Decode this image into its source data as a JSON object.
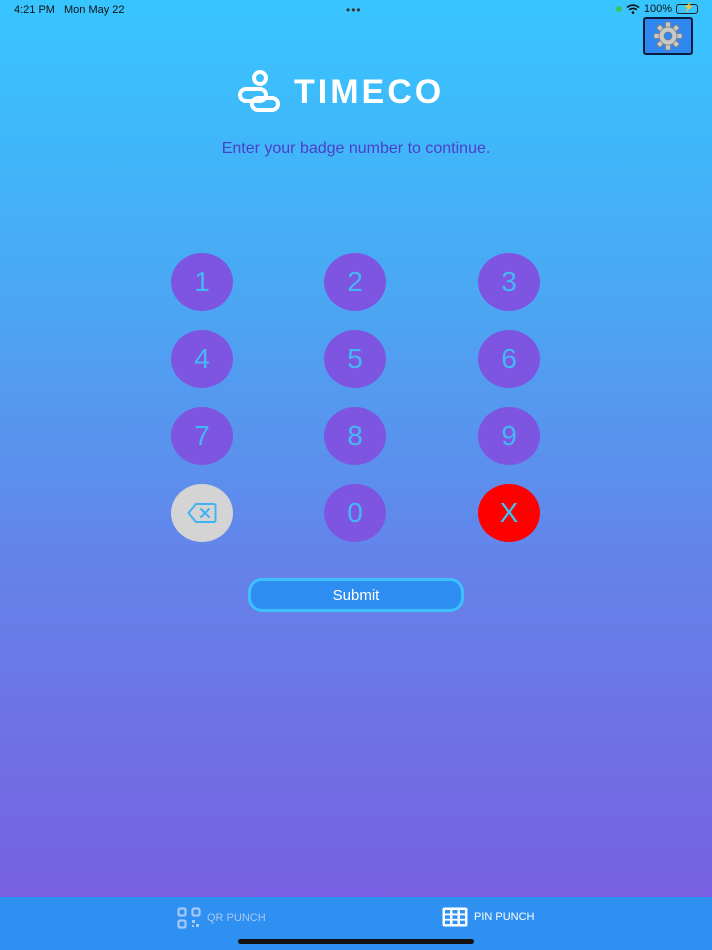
{
  "status_bar": {
    "time": "4:21 PM",
    "date": "Mon May 22",
    "battery": "100%"
  },
  "brand": {
    "name": "TIMECO"
  },
  "prompt": "Enter your badge number to continue.",
  "keypad": {
    "keys": [
      "1",
      "2",
      "3",
      "4",
      "5",
      "6",
      "7",
      "8",
      "9",
      "0"
    ],
    "clear_label": "X"
  },
  "submit_label": "Submit",
  "tabs": {
    "qr_label": "QR PUNCH",
    "pin_label": "PIN PUNCH"
  },
  "colors": {
    "key": "#7d55e0",
    "clear": "#ff0000",
    "tab_bar": "#2e90f0",
    "accent": "#37c5ff"
  }
}
